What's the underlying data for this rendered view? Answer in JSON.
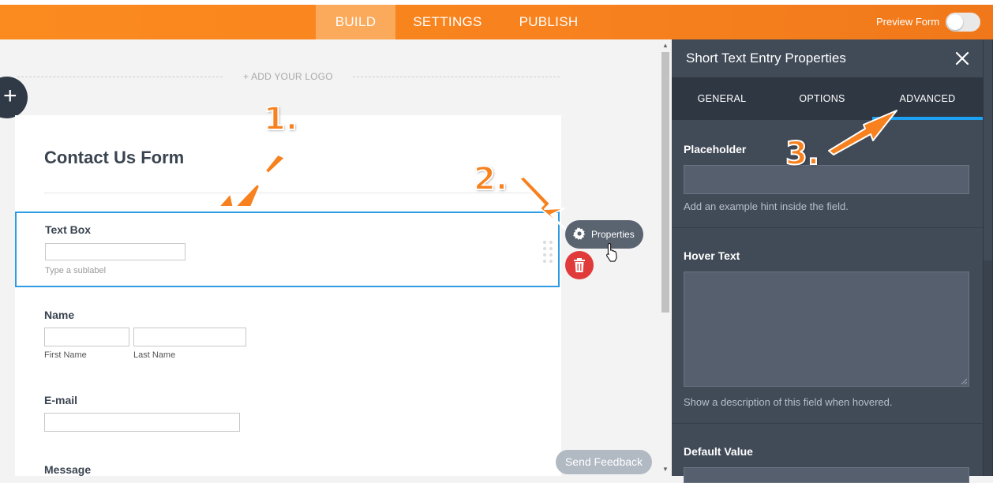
{
  "topbar": {
    "tabs": [
      {
        "label": "BUILD",
        "active": true
      },
      {
        "label": "SETTINGS",
        "active": false
      },
      {
        "label": "PUBLISH",
        "active": false
      }
    ],
    "preview_label": "Preview Form",
    "preview_on": false,
    "accent_color": "#f7811e"
  },
  "canvas": {
    "add_logo": "+ ADD YOUR LOGO",
    "add_button": "+"
  },
  "form": {
    "title": "Contact Us Form",
    "fields": {
      "textbox": {
        "label": "Text Box",
        "sublabel": "Type a sublabel"
      },
      "name": {
        "label": "Name",
        "first": "First Name",
        "last": "Last Name"
      },
      "email": {
        "label": "E-mail"
      },
      "message": {
        "label": "Message"
      }
    }
  },
  "field_actions": {
    "properties_label": "Properties"
  },
  "feedback_label": "Send Feedback",
  "panel": {
    "title": "Short Text Entry Properties",
    "tabs": [
      {
        "label": "GENERAL",
        "active": false
      },
      {
        "label": "OPTIONS",
        "active": false
      },
      {
        "label": "ADVANCED",
        "active": true
      }
    ],
    "placeholder": {
      "label": "Placeholder",
      "value": "",
      "help": "Add an example hint inside the field."
    },
    "hover_text": {
      "label": "Hover Text",
      "value": "",
      "help": "Show a description of this field when hovered."
    },
    "default_value": {
      "label": "Default Value"
    }
  },
  "annotations": {
    "step1": "1.",
    "step2": "2.",
    "step3": "3."
  }
}
